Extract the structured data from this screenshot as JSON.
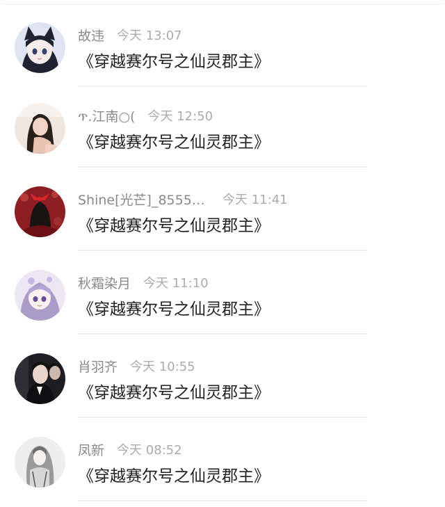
{
  "comments": [
    {
      "username": "故违",
      "time": "今天 13:07",
      "content": "《穿越赛尔号之仙灵郡主》",
      "avatar": "anime-girl-cat-ears-avatar"
    },
    {
      "username": "ጥ.江南○(",
      "time": "今天 12:50",
      "content": "《穿越赛尔号之仙灵郡主》",
      "avatar": "girl-photo-avatar"
    },
    {
      "username": "Shine[光芒]_85551...",
      "time": "今天 11:41",
      "content": "《穿越赛尔号之仙灵郡主》",
      "avatar": "red-bow-girl-avatar"
    },
    {
      "username": "秋霜染月",
      "time": "今天 11:10",
      "content": "《穿越赛尔号之仙灵郡主》",
      "avatar": "purple-hair-anime-avatar"
    },
    {
      "username": "肖羽齐",
      "time": "今天 10:55",
      "content": "《穿越赛尔号之仙灵郡主》",
      "avatar": "man-portrait-avatar"
    },
    {
      "username": "凤新",
      "time": "今天 08:52",
      "content": "《穿越赛尔号之仙灵郡主》",
      "avatar": "long-hair-drawing-avatar"
    }
  ]
}
